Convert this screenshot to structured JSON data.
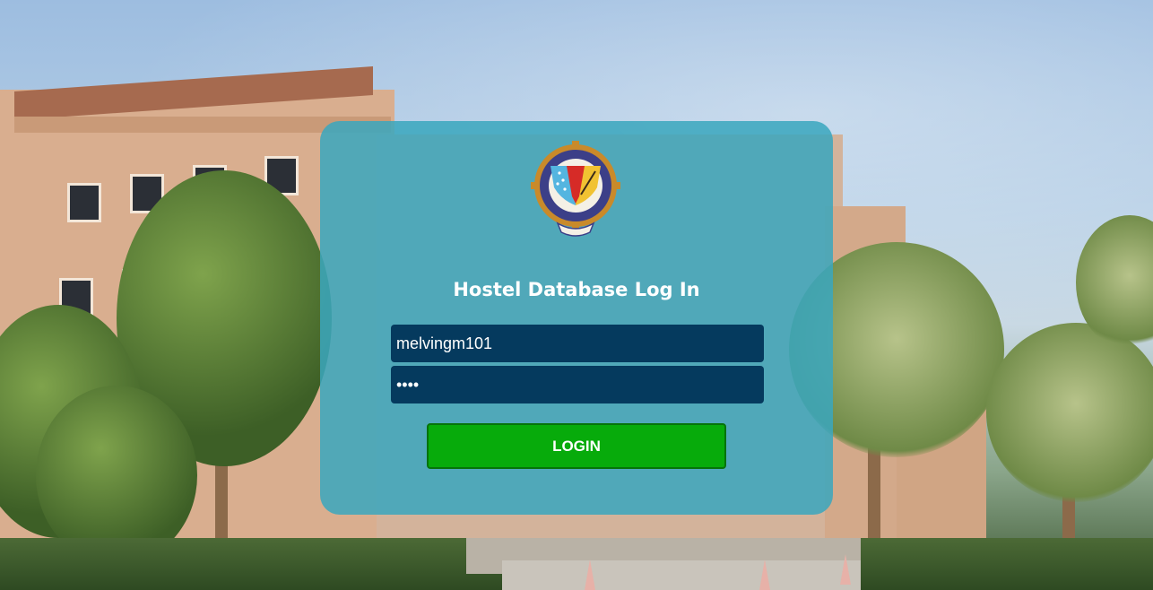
{
  "login": {
    "title": "Hostel Database Log In",
    "username_value": "melvingm101",
    "password_value": "••••",
    "login_label": "LOGIN"
  },
  "logo": {
    "icon": "bits-pilani-emblem-icon",
    "colors": {
      "outer_ring": "#c98a2a",
      "ring": "#3c3f88",
      "left_panel": "#54b5e0",
      "right_panel": "#f1c232",
      "center": "#d62b27"
    }
  },
  "colors": {
    "panel": "#3aa6be",
    "field_bg": "#053a5e",
    "button_bg": "#07ab0b",
    "text": "#ffffff"
  }
}
